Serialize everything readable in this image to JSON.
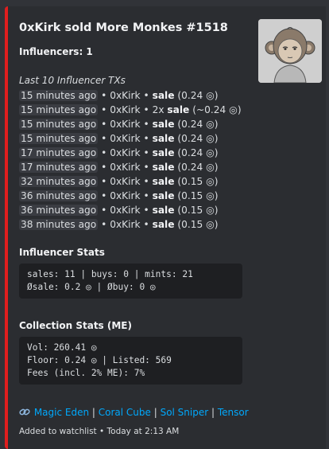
{
  "embed": {
    "accent_color": "#e01e1e",
    "title": "0xKirk sold More Monkes #1518",
    "influencers_label": "Influencers: 1",
    "tx_heading": "Last 10 Influencer TXs",
    "transactions": [
      {
        "time": "15 minutes ago",
        "user": "0xKirk",
        "prefix": "",
        "action": "sale",
        "amount": "(0.24 ◎)"
      },
      {
        "time": "15 minutes ago",
        "user": "0xKirk",
        "prefix": "2x ",
        "action": "sale",
        "amount": "(~0.24 ◎)"
      },
      {
        "time": "15 minutes ago",
        "user": "0xKirk",
        "prefix": "",
        "action": "sale",
        "amount": "(0.24 ◎)"
      },
      {
        "time": "15 minutes ago",
        "user": "0xKirk",
        "prefix": "",
        "action": "sale",
        "amount": "(0.24 ◎)"
      },
      {
        "time": "17 minutes ago",
        "user": "0xKirk",
        "prefix": "",
        "action": "sale",
        "amount": "(0.24 ◎)"
      },
      {
        "time": "17 minutes ago",
        "user": "0xKirk",
        "prefix": "",
        "action": "sale",
        "amount": "(0.24 ◎)"
      },
      {
        "time": "32 minutes ago",
        "user": "0xKirk",
        "prefix": "",
        "action": "sale",
        "amount": "(0.15 ◎)"
      },
      {
        "time": "36 minutes ago",
        "user": "0xKirk",
        "prefix": "",
        "action": "sale",
        "amount": "(0.15 ◎)"
      },
      {
        "time": "36 minutes ago",
        "user": "0xKirk",
        "prefix": "",
        "action": "sale",
        "amount": "(0.15 ◎)"
      },
      {
        "time": "38 minutes ago",
        "user": "0xKirk",
        "prefix": "",
        "action": "sale",
        "amount": "(0.15 ◎)"
      }
    ],
    "influencer_stats_label": "Influencer Stats",
    "influencer_stats_lines": [
      "sales: 11 | buys: 0 | mints: 21",
      "Øsale: 0.2 ◎ | Øbuy: 0 ◎"
    ],
    "collection_stats_label": "Collection Stats (ME)",
    "collection_stats_lines": [
      "Vol: 260.41 ◎",
      "Floor: 0.24 ◎ | Listed: 569",
      "Fees (incl. 2% ME): 7%"
    ],
    "links_icon": "link-icon",
    "links": [
      "Magic Eden",
      "Coral Cube",
      "Sol Sniper",
      "Tensor"
    ],
    "link_separator": " | ",
    "footer": "Added to watchlist • Today at 2:13 AM",
    "thumbnail_icon": "monkey-avatar-icon"
  }
}
